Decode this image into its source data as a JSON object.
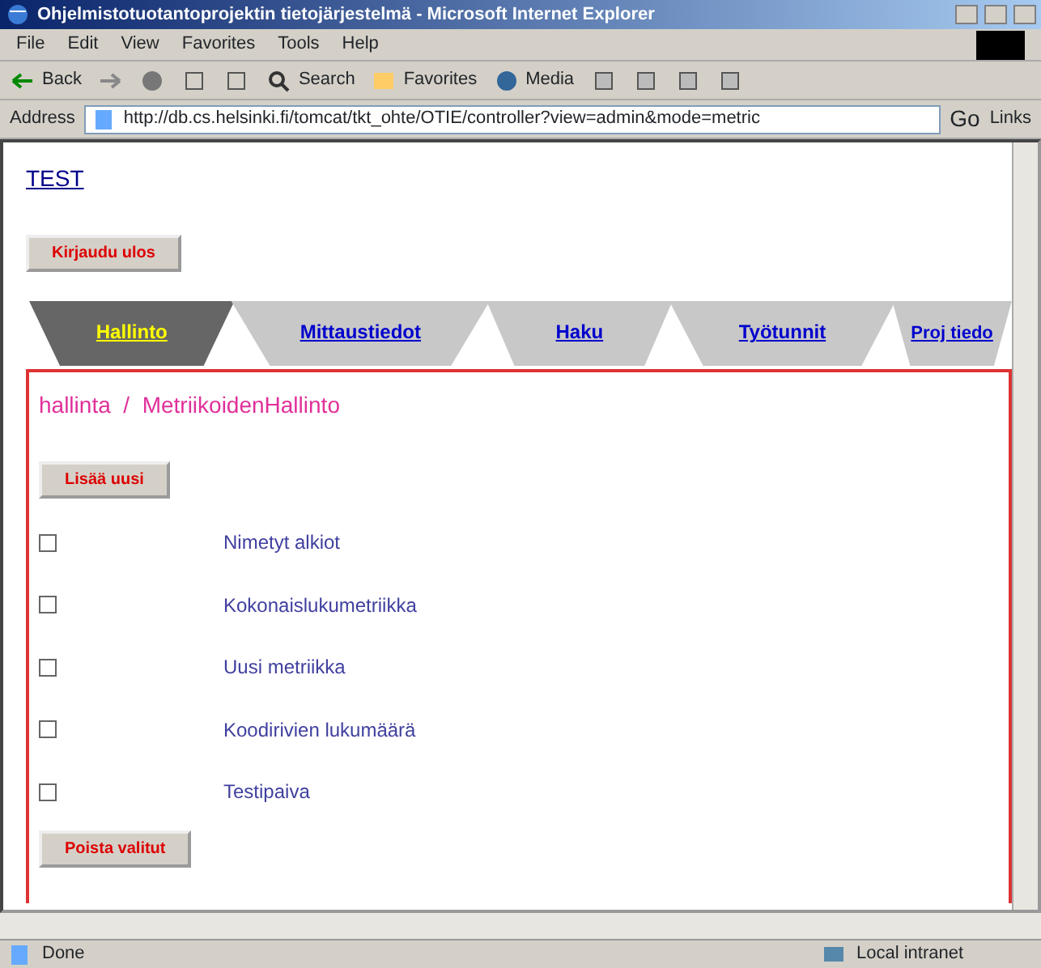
{
  "window": {
    "title": "Ohjelmistotuotantoprojektin tietojärjestelmä - Microsoft Internet Explorer"
  },
  "menu": [
    "File",
    "Edit",
    "View",
    "Favorites",
    "Tools",
    "Help"
  ],
  "toolbar": [
    {
      "kind": "back",
      "label": "Back"
    },
    {
      "kind": "search",
      "label": "Search"
    },
    {
      "kind": "favorites",
      "label": "Favorites"
    },
    {
      "kind": "media",
      "label": "Media"
    }
  ],
  "address": {
    "label": "Address",
    "value": "http://db.cs.helsinki.fi/tomcat/tkt_ohte/OTIE/controller?view=admin&mode=metric",
    "go": "Go",
    "links": "Links"
  },
  "page": {
    "link": "TEST",
    "logout": "Kirjaudu ulos",
    "tabs": [
      {
        "label": "Hallinto",
        "selected": true
      },
      {
        "label": "Mittaustiedot",
        "selected": false
      },
      {
        "label": "Haku",
        "selected": false
      },
      {
        "label": "Työtunnit",
        "selected": false
      },
      {
        "label": "Proj tiedo",
        "selected": false
      }
    ],
    "breadcrumb": "hallinta  /  MetriikoidenHallinto",
    "add_button": "Lisää uusi",
    "metrics": [
      {
        "label": "Nimetyt alkiot",
        "checked": false
      },
      {
        "label": "Kokonaislukumetriikka",
        "checked": false
      },
      {
        "label": "Uusi metriikka",
        "checked": false
      },
      {
        "label": "Koodirivien lukumäärä",
        "checked": false
      },
      {
        "label": "Testipaiva",
        "checked": false
      }
    ],
    "delete_button": "Poista valitut"
  },
  "status_bar": {
    "text": "Done",
    "zone": "Local intranet"
  }
}
